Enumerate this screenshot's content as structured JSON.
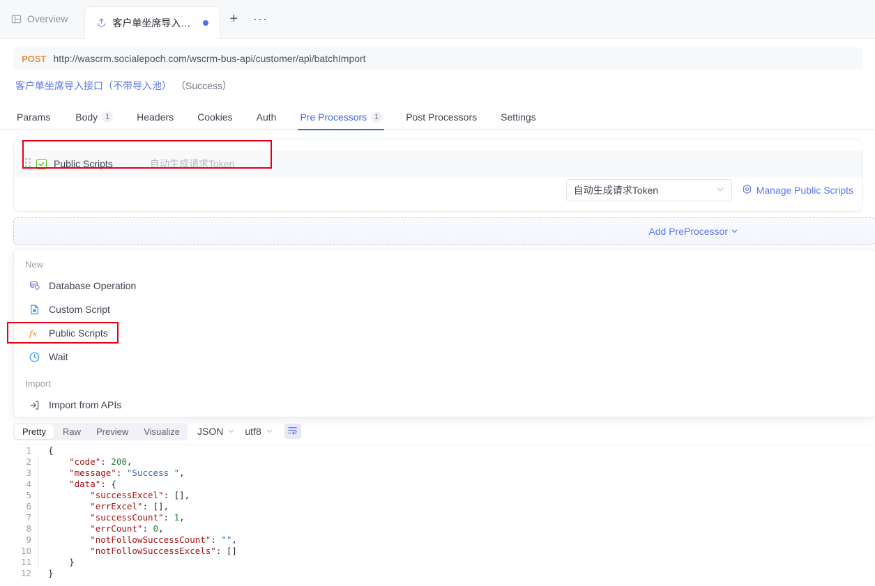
{
  "window": {
    "tabs": [
      {
        "icon": "layout-icon",
        "label": "Overview",
        "active": false,
        "dirty": false
      },
      {
        "icon": "upload-icon",
        "label": "客户单坐席导入接...",
        "active": true,
        "dirty": true
      }
    ],
    "new_tab_label": "+",
    "more_tabs_label": "···"
  },
  "request": {
    "method": "POST",
    "url": "http://wascrm.socialepoch.com/wscrm-bus-api/customer/api/batchImport",
    "name": "客户单坐席导入接口（不带导入池）",
    "status": "（Success）"
  },
  "subtabs": [
    {
      "label": "Params",
      "badge": "",
      "active": false
    },
    {
      "label": "Body",
      "badge": "1",
      "active": false
    },
    {
      "label": "Headers",
      "badge": "",
      "active": false
    },
    {
      "label": "Cookies",
      "badge": "",
      "active": false
    },
    {
      "label": "Auth",
      "badge": "",
      "active": false
    },
    {
      "label": "Pre Processors",
      "badge": "1",
      "active": true
    },
    {
      "label": "Post Processors",
      "badge": "",
      "active": false
    },
    {
      "label": "Settings",
      "badge": "",
      "active": false
    }
  ],
  "preprocessor": {
    "row": {
      "drag_handle": "drag-handle-icon",
      "checkbox_checked": true,
      "name": "Public Scripts",
      "description": "自动生成请求Token"
    },
    "script_select_value": "自动生成请求Token",
    "manage_link": "Manage Public Scripts",
    "manage_icon": "gear-icon",
    "add_label": "Add PreProcessor"
  },
  "menu": {
    "sections": [
      {
        "title": "New",
        "items": [
          {
            "icon": "database-icon",
            "label": "Database Operation",
            "highlighted": false
          },
          {
            "icon": "script-file-icon",
            "label": "Custom Script",
            "highlighted": false
          },
          {
            "icon": "fx-icon",
            "label": "Public Scripts",
            "highlighted": true
          },
          {
            "icon": "clock-icon",
            "label": "Wait",
            "highlighted": false
          }
        ]
      },
      {
        "title": "Import",
        "items": [
          {
            "icon": "import-arrow-icon",
            "label": "Import from APIs",
            "highlighted": false
          }
        ]
      }
    ]
  },
  "response": {
    "view_modes": [
      "Pretty",
      "Raw",
      "Preview",
      "Visualize"
    ],
    "active_view_mode": "Pretty",
    "format": "JSON",
    "encoding": "utf8",
    "wrap_icon": "wrap-text-icon",
    "lines": [
      {
        "no": "1",
        "guide": false,
        "tokens": [
          {
            "t": "p",
            "v": "{"
          }
        ]
      },
      {
        "no": "2",
        "guide": true,
        "tokens": [
          {
            "t": "k",
            "v": "    \"code\""
          },
          {
            "t": "p",
            "v": ": "
          },
          {
            "t": "n",
            "v": "200"
          },
          {
            "t": "p",
            "v": ","
          }
        ]
      },
      {
        "no": "3",
        "guide": true,
        "tokens": [
          {
            "t": "k",
            "v": "    \"message\""
          },
          {
            "t": "p",
            "v": ": "
          },
          {
            "t": "s",
            "v": "\"Success \""
          },
          {
            "t": "p",
            "v": ","
          }
        ]
      },
      {
        "no": "4",
        "guide": true,
        "tokens": [
          {
            "t": "k",
            "v": "    \"data\""
          },
          {
            "t": "p",
            "v": ": {"
          }
        ]
      },
      {
        "no": "5",
        "guide": true,
        "tokens": [
          {
            "t": "k",
            "v": "        \"successExcel\""
          },
          {
            "t": "p",
            "v": ": [],"
          }
        ]
      },
      {
        "no": "6",
        "guide": true,
        "tokens": [
          {
            "t": "k",
            "v": "        \"errExcel\""
          },
          {
            "t": "p",
            "v": ": [],"
          }
        ]
      },
      {
        "no": "7",
        "guide": true,
        "tokens": [
          {
            "t": "k",
            "v": "        \"successCount\""
          },
          {
            "t": "p",
            "v": ": "
          },
          {
            "t": "n",
            "v": "1"
          },
          {
            "t": "p",
            "v": ","
          }
        ]
      },
      {
        "no": "8",
        "guide": true,
        "tokens": [
          {
            "t": "k",
            "v": "        \"errCount\""
          },
          {
            "t": "p",
            "v": ": "
          },
          {
            "t": "n",
            "v": "0"
          },
          {
            "t": "p",
            "v": ","
          }
        ]
      },
      {
        "no": "9",
        "guide": true,
        "tokens": [
          {
            "t": "k",
            "v": "        \"notFollowSuccessCount\""
          },
          {
            "t": "p",
            "v": ": "
          },
          {
            "t": "s",
            "v": "\"\""
          },
          {
            "t": "p",
            "v": ","
          }
        ]
      },
      {
        "no": "10",
        "guide": true,
        "tokens": [
          {
            "t": "k",
            "v": "        \"notFollowSuccessExcels\""
          },
          {
            "t": "p",
            "v": ": []"
          }
        ]
      },
      {
        "no": "11",
        "guide": true,
        "tokens": [
          {
            "t": "p",
            "v": "    }"
          }
        ]
      },
      {
        "no": "12",
        "guide": false,
        "tokens": [
          {
            "t": "p",
            "v": "}"
          }
        ]
      }
    ]
  },
  "annotations": {
    "highlight_color": "#e60012",
    "boxes": [
      "preprocessor-row",
      "menu-public-scripts"
    ]
  },
  "colors": {
    "accent_blue": "#4169e1",
    "link_blue": "#5a77e8",
    "method_orange": "#e8913a",
    "checkbox_green": "#52c41a",
    "dirty_dot": "#4c6ef5"
  }
}
